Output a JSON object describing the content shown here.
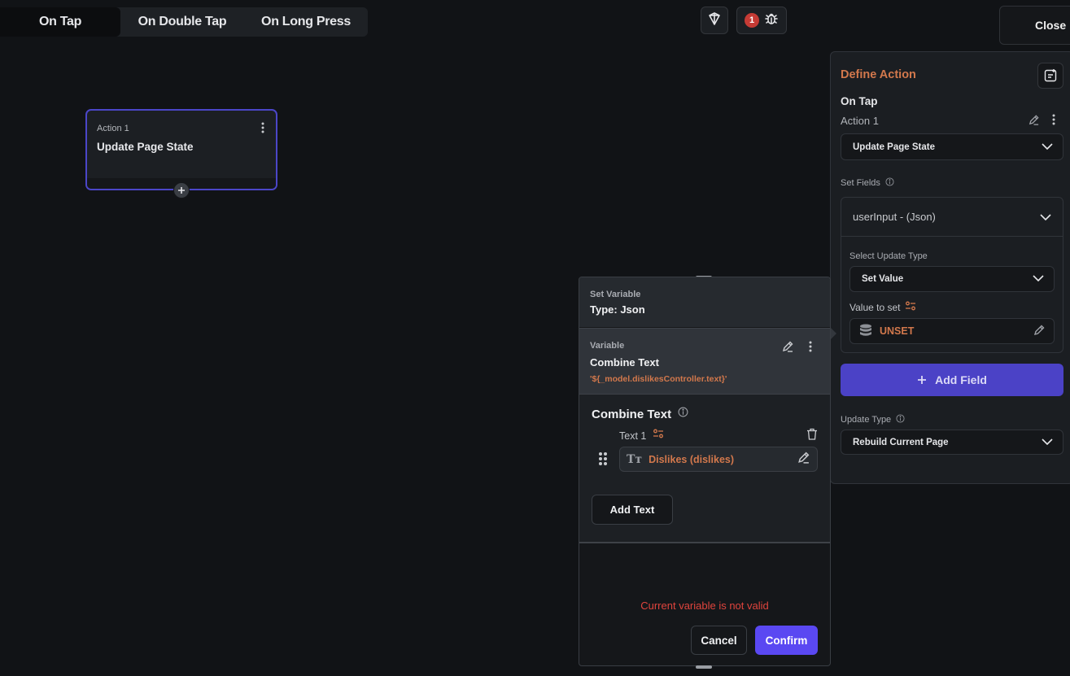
{
  "tabs": [
    {
      "label": "On Tap",
      "active": true
    },
    {
      "label": "On Double Tap",
      "active": false
    },
    {
      "label": "On Long Press",
      "active": false
    }
  ],
  "toolbar": {
    "error_count": "1",
    "close_label": "Close"
  },
  "canvas": {
    "node": {
      "kicker": "Action 1",
      "title": "Update Page State"
    }
  },
  "define_action": {
    "title": "Define Action",
    "trigger": "On Tap",
    "action_name": "Action 1",
    "action_type": "Update Page State",
    "set_fields_label": "Set Fields",
    "field_name": "userInput - (Json)",
    "select_update_type_label": "Select Update Type",
    "update_type_value": "Set Value",
    "value_to_set_label": "Value to set",
    "value_state": "UNSET",
    "add_field_label": "Add Field",
    "update_type_label": "Update Type",
    "rebuild_value": "Rebuild Current Page"
  },
  "set_variable": {
    "kicker": "Set Variable",
    "type_label": "Type: Json",
    "variable_label": "Variable",
    "variable_name": "Combine Text",
    "variable_code": "'${_model.dislikesController.text}'",
    "section_title": "Combine Text",
    "text1_label": "Text 1",
    "text1_value": "Dislikes (dislikes)",
    "add_text_label": "Add Text",
    "error_message": "Current variable is not valid",
    "cancel_label": "Cancel",
    "confirm_label": "Confirm"
  },
  "colors": {
    "accent_orange": "#d2784c",
    "primary_purple": "#4b42c6",
    "error_red": "#e0443d"
  }
}
